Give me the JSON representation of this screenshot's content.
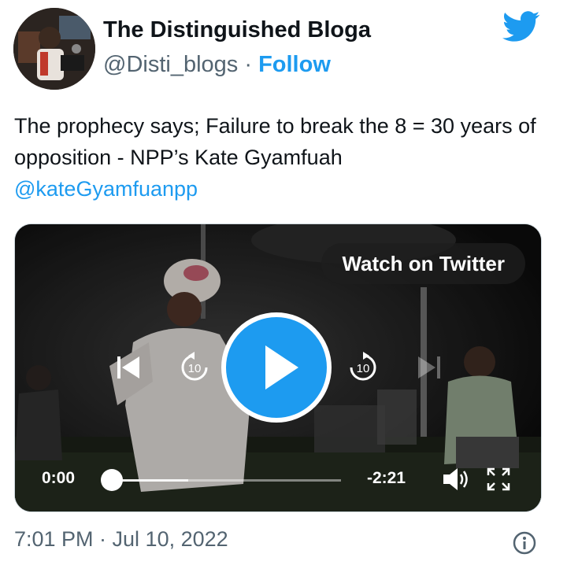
{
  "author": {
    "display_name": "The Distinguished Bloga",
    "handle": "@Disti_blogs",
    "separator": " · ",
    "follow_label": "Follow"
  },
  "icons": {
    "brand": "twitter-bird-icon",
    "info": "info-icon",
    "play": "play-icon",
    "skip_back": "skip-back-icon",
    "rewind": "rewind-10-icon",
    "forward": "forward-10-icon",
    "skip_next": "skip-next-icon",
    "volume": "volume-icon",
    "fullscreen": "fullscreen-icon"
  },
  "tweet": {
    "text_line": "The prophecy says; Failure to break the 8 = 30 years of opposition - NPP’s Kate Gyamfuah",
    "mention": "@kateGyamfuanpp"
  },
  "video": {
    "watch_label": "Watch on Twitter",
    "rewind_seconds": "10",
    "forward_seconds": "10",
    "current_time": "0:00",
    "remaining_time": "-2:21",
    "progress_fraction": 0
  },
  "footer": {
    "timestamp": "7:01 PM · Jul 10, 2022"
  },
  "colors": {
    "accent": "#1d9bf0",
    "text": "#0f1419",
    "secondary": "#536471"
  }
}
